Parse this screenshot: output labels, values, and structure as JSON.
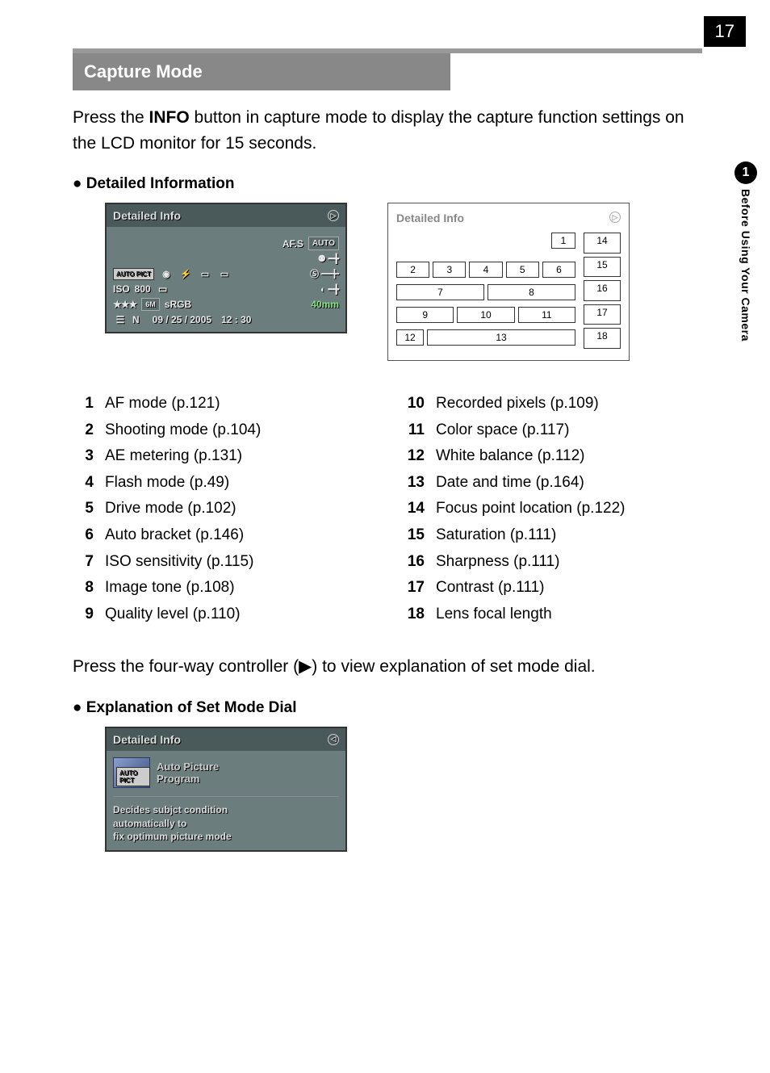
{
  "page_number": "17",
  "side_tab": {
    "number": "1",
    "label": "Before Using Your Camera"
  },
  "section_header": "Capture Mode",
  "intro_prefix": "Press the ",
  "intro_bold": "INFO",
  "intro_suffix": " button in capture mode to display the capture function settings on the LCD monitor for 15 seconds.",
  "bullet1": "Detailed Information",
  "lcd": {
    "title": "Detailed Info",
    "afs": "AF.S",
    "auto": "AUTO",
    "row2_autopict": "AUTO PICT",
    "row3_iso": "ISO",
    "row3_iso_val": "800",
    "row4_6m": "6M",
    "row4_srgb": "sRGB",
    "row4_mm": "40mm",
    "row5_n": "N",
    "row5_date": "09 / 25 / 2005",
    "row5_time": "12 : 30",
    "stars": "★★★"
  },
  "diagram": {
    "title": "Detailed Info",
    "cells": {
      "c1": "1",
      "c2": "2",
      "c3": "3",
      "c4": "4",
      "c5": "5",
      "c6": "6",
      "c7": "7",
      "c8": "8",
      "c9": "9",
      "c10": "10",
      "c11": "11",
      "c12": "12",
      "c13": "13",
      "c14": "14",
      "c15": "15",
      "c16": "16",
      "c17": "17",
      "c18": "18"
    }
  },
  "legend_left": [
    {
      "n": "1",
      "t": "AF mode (p.121)"
    },
    {
      "n": "2",
      "t": "Shooting mode (p.104)"
    },
    {
      "n": "3",
      "t": "AE metering (p.131)"
    },
    {
      "n": "4",
      "t": "Flash mode (p.49)"
    },
    {
      "n": "5",
      "t": "Drive mode (p.102)"
    },
    {
      "n": "6",
      "t": "Auto bracket (p.146)"
    },
    {
      "n": "7",
      "t": "ISO sensitivity (p.115)"
    },
    {
      "n": "8",
      "t": "Image tone (p.108)"
    },
    {
      "n": "9",
      "t": "Quality level (p.110)"
    }
  ],
  "legend_right": [
    {
      "n": "10",
      "t": "Recorded pixels (p.109)"
    },
    {
      "n": "11",
      "t": "Color space (p.117)"
    },
    {
      "n": "12",
      "t": "White balance (p.112)"
    },
    {
      "n": "13",
      "t": "Date and time (p.164)"
    },
    {
      "n": "14",
      "t": "Focus point location (p.122)"
    },
    {
      "n": "15",
      "t": "Saturation (p.111)"
    },
    {
      "n": "16",
      "t": "Sharpness (p.111)"
    },
    {
      "n": "17",
      "t": "Contrast (p.111)"
    },
    {
      "n": "18",
      "t": "Lens focal length"
    }
  ],
  "four_way_text_prefix": "Press the four-way controller (",
  "four_way_symbol": "▶",
  "four_way_text_suffix": ") to view explanation of set mode dial.",
  "bullet2": "Explanation of Set Mode Dial",
  "lcd2": {
    "title": "Detailed Info",
    "chip": "AUTO PICT",
    "mode_l1": "Auto Picture",
    "mode_l2": "Program",
    "desc_l1": "Decides subjct condition",
    "desc_l2": "automatically to",
    "desc_l3": "fix optimum picture mode"
  }
}
